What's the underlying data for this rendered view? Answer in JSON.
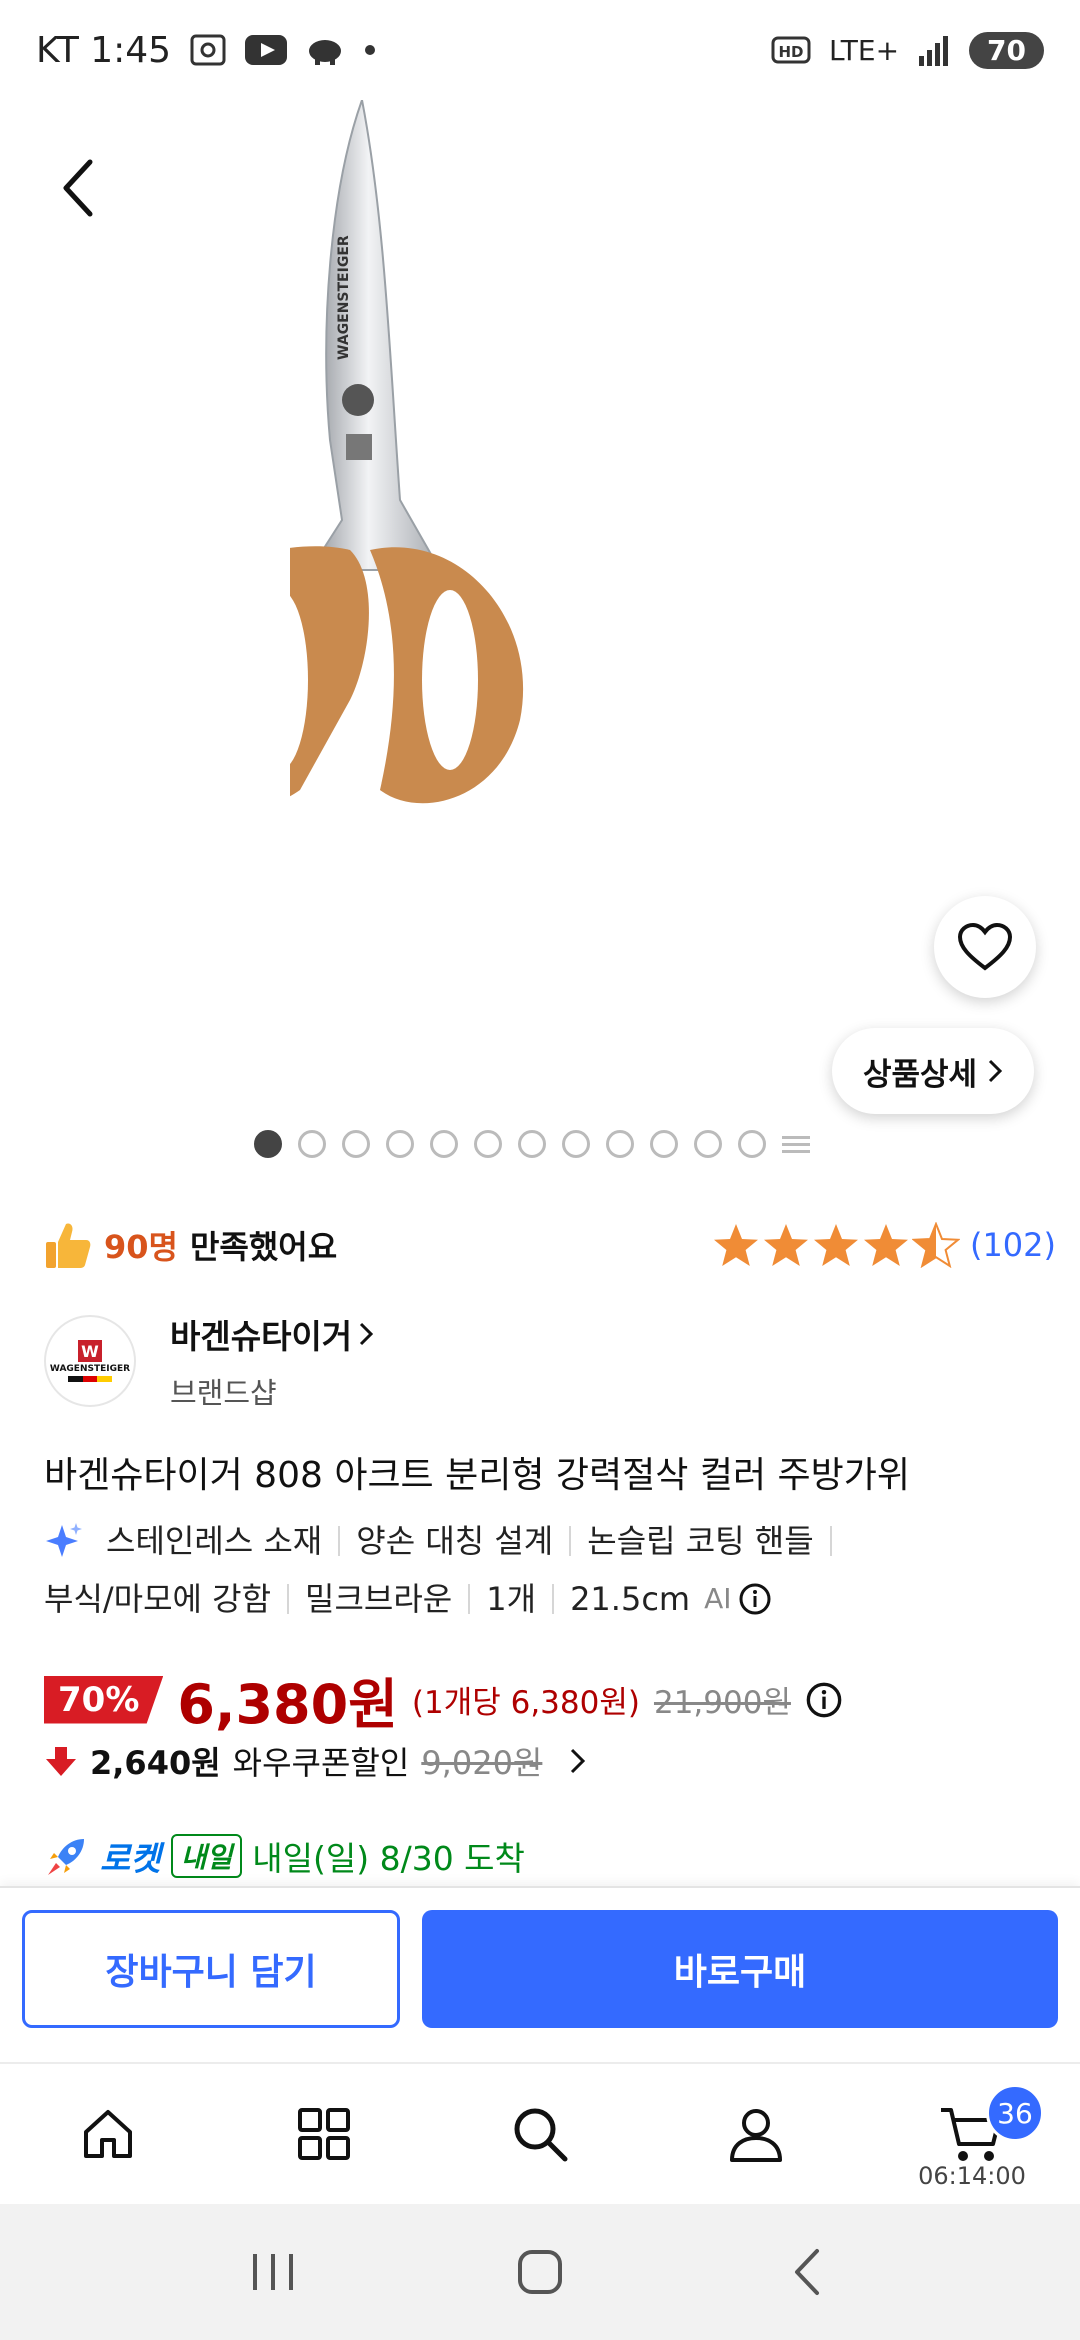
{
  "status_bar": {
    "carrier_time": "KT 1:45",
    "network": "LTE+",
    "battery": "70"
  },
  "product": {
    "image_dots_total": 12,
    "image_dots_active_index": 0,
    "detail_button": "상품상세",
    "satisfied_count": "90명",
    "satisfied_text": "만족했어요",
    "rating": 4.5,
    "review_count": "(102)",
    "brand_name": "바겐슈타이거",
    "brand_sub": "브랜드샵",
    "brand_logo_text": "WAGENSTEIGER",
    "title": "바겐슈타이거 808 아크트 분리형 강력절삭 컬러 주방가위",
    "attributes_line1": [
      "스테인레스 소재",
      "양손 대칭 설계",
      "논슬립 코팅 핸들"
    ],
    "attributes_line2": [
      "부식/마모에 강함",
      "밀크브라운",
      "1개",
      "21.5cm"
    ],
    "ai_label": "AI"
  },
  "price": {
    "discount": "70%",
    "sale_price": "6,380원",
    "unit_price": "(1개당 6,380원)",
    "original_price": "21,900원",
    "coupon_price": "2,640원",
    "coupon_label": "와우쿠폰할인",
    "coupon_original": "9,020원"
  },
  "delivery": {
    "rocket": "로켓",
    "tomorrow_badge": "내일",
    "text": "내일(일) 8/30 도착"
  },
  "actions": {
    "cart_button": "장바구니 담기",
    "buy_button": "바로구매"
  },
  "bottom_nav": {
    "cart_count": "36",
    "cart_timer": "06:14:00"
  },
  "colors": {
    "accent": "#346aff",
    "price_red": "#ae0000",
    "discount_red": "#d81c24",
    "star_orange": "#f08c36",
    "handle_brown": "#c98a4e"
  }
}
